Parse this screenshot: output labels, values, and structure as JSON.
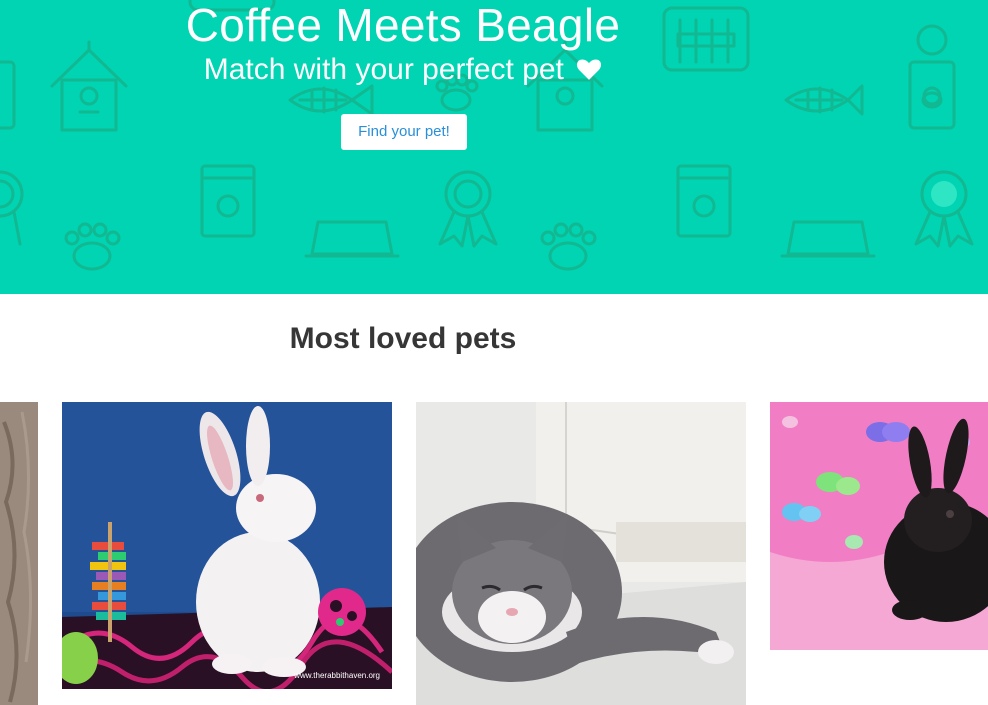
{
  "hero": {
    "title": "Coffee Meets Beagle",
    "subtitle": "Match with your perfect pet",
    "heart_icon": "heart-icon",
    "cta_label": "Find your pet!",
    "background_color": "#00d4b2",
    "pattern_icons": [
      "birdhouse-icon",
      "pet-carrier-icon",
      "fish-bone-icon",
      "pet-food-can-icon",
      "award-ribbon-icon",
      "paw-print-icon",
      "food-bowl-icon"
    ]
  },
  "section": {
    "title": "Most loved pets"
  },
  "pets": [
    {
      "card": "pet-card-partial",
      "subject": "tabby-fur"
    },
    {
      "card": "pet-card-white-rabbit",
      "subject": "white rabbit",
      "watermark": "www.therabbithaven.org"
    },
    {
      "card": "pet-card-gray-cat",
      "subject": "gray and white cat"
    },
    {
      "card": "pet-card-black-rabbit",
      "subject": "black rabbit"
    }
  ],
  "colors": {
    "accent": "#00d4b2",
    "button_text": "#2b8fd8",
    "heading": "#363636"
  }
}
